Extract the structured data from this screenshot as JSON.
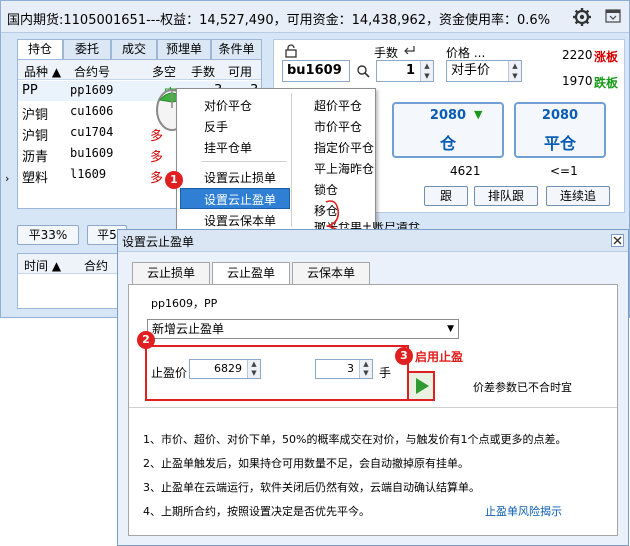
{
  "window": {
    "title": "国内期货:1105001651---权益：14,527,490，可用资金：14,438,962，资金使用率：0.6%"
  },
  "left_tabs": [
    {
      "label": "持仓",
      "active": true
    },
    {
      "label": "委托",
      "active": false
    },
    {
      "label": "成交",
      "active": false
    },
    {
      "label": "预埋单",
      "active": false
    },
    {
      "label": "条件单",
      "active": false
    }
  ],
  "positions": {
    "columns": [
      "品种 ▲",
      "合约号",
      "多空",
      "手数",
      "可用"
    ],
    "rows": [
      {
        "product": "PP",
        "contract": "pp1609",
        "side": "空",
        "qty": "3",
        "avail": "3"
      },
      {
        "product": "沪铜",
        "contract": "cu1606",
        "side": "",
        "qty": "",
        "avail": ""
      },
      {
        "product": "沪铜",
        "contract": "cu1704",
        "side": "多",
        "qty": "",
        "avail": ""
      },
      {
        "product": "沥青",
        "contract": "bu1609",
        "side": "多",
        "qty": "",
        "avail": ""
      },
      {
        "product": "塑料",
        "contract": "l1609",
        "side": "多",
        "qty": "",
        "avail": ""
      }
    ],
    "row_marker": "›"
  },
  "quick_buttons": [
    "平33%",
    "平5"
  ],
  "orders": {
    "columns": [
      "时间 ▲",
      "合约"
    ]
  },
  "order_panel": {
    "qty_label": "手数",
    "price_label": "价格 ...",
    "contract_value": "bu1609",
    "qty_value": "1",
    "price_value": "对手价",
    "limit_up_value": "2220",
    "limit_up_label": "涨板",
    "limit_down_value": "1970",
    "limit_down_label": "跌板",
    "left_btn_price": "2080",
    "left_btn_action": "仓",
    "right_btn_price": "2080",
    "right_btn_action": "平仓",
    "sub_left": "4621",
    "sub_right": "<=1",
    "cmd_left": "跟",
    "cmd_queue": "排队跟",
    "cmd_chase": "连续追"
  },
  "context_menu": {
    "left": [
      "对价平仓",
      "反手",
      "挂平仓单",
      "设置云止损单",
      "设置云止盈单",
      "设置云保本单"
    ],
    "right": [
      "超价平仓",
      "市价平仓",
      "指定价平仓",
      "平上海昨仓",
      "锁仓",
      "移仓",
      "撤平仓单+账户清仓"
    ],
    "highlighted": "设置云止盈单"
  },
  "dialog": {
    "title": "设置云止盈单",
    "tabs": [
      {
        "label": "云止损单",
        "active": false
      },
      {
        "label": "云止盈单",
        "active": true
      },
      {
        "label": "云保本单",
        "active": false
      }
    ],
    "contract_info": "pp1609，PP",
    "select_value": "新增云止盈单",
    "price_label": "止盈价",
    "price_value": "6829",
    "qty_value": "3",
    "qty_unit": "手",
    "start_label": "启用止盈",
    "warning": "价差参数已不合时宜",
    "notes": [
      "1、市价、超价、对价下单，50%的概率成交在对价，与触发价有1个点或更多的点差。",
      "2、止盈单触发后，如果持仓可用数量不足，会自动撤掉原有挂单。",
      "3、止盈单在云端运行，软件关闭后仍然有效，云端自动确认结算单。",
      "4、上期所合约，按照设置决定是否优先平今。"
    ],
    "risk_link": "止盈单风险揭示"
  },
  "badges": [
    "1",
    "2",
    "3"
  ],
  "colors": {
    "accent": "#2f80d4",
    "highlight_red": "#e02020",
    "limit_up": "#d40000",
    "limit_down": "#1a9a1a",
    "price_blue": "#0b5db3"
  }
}
